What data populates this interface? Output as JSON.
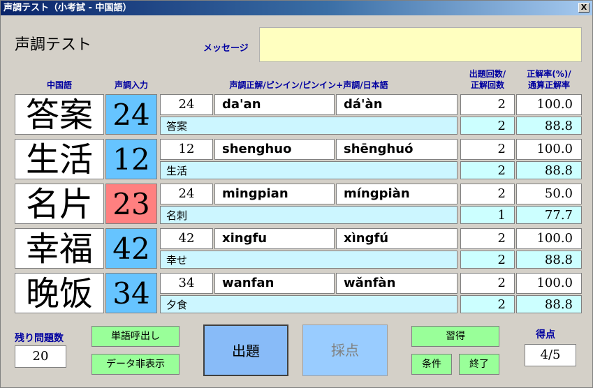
{
  "window": {
    "title": "声調テスト（小考試 - 中国語）",
    "close_label": "X"
  },
  "app": {
    "title": "声調テスト",
    "message_label": "メッセージ",
    "message_value": ""
  },
  "headers": {
    "chinese": "中国語",
    "tone_input": "声調入力",
    "answers": "声調正解/ピンイン/ピンイン+声調/日本語",
    "count1": "出題回数/",
    "count2": "正解回数",
    "rate1": "正解率(%)/",
    "rate2": "通算正解率"
  },
  "rows": [
    {
      "word": "答案",
      "tone_input": "24",
      "tone_correct": "24",
      "pinyin": "da'an",
      "pinyin_tone": "dá'àn",
      "japanese": "答案",
      "asked": "2",
      "correct": "2",
      "rate": "100.0",
      "total_rate": "88.8",
      "status": "correct"
    },
    {
      "word": "生活",
      "tone_input": "12",
      "tone_correct": "12",
      "pinyin": "shenghuo",
      "pinyin_tone": "shēnghuó",
      "japanese": "生活",
      "asked": "2",
      "correct": "2",
      "rate": "100.0",
      "total_rate": "88.8",
      "status": "correct"
    },
    {
      "word": "名片",
      "tone_input": "23",
      "tone_correct": "24",
      "pinyin": "mingpian",
      "pinyin_tone": "míngpiàn",
      "japanese": "名刺",
      "asked": "2",
      "correct": "1",
      "rate": "50.0",
      "total_rate": "77.7",
      "status": "wrong"
    },
    {
      "word": "幸福",
      "tone_input": "42",
      "tone_correct": "42",
      "pinyin": "xingfu",
      "pinyin_tone": "xìngfú",
      "japanese": "幸せ",
      "asked": "2",
      "correct": "2",
      "rate": "100.0",
      "total_rate": "88.8",
      "status": "correct"
    },
    {
      "word": "晚饭",
      "tone_input": "34",
      "tone_correct": "34",
      "pinyin": "wanfan",
      "pinyin_tone": "wǎnfàn",
      "japanese": "夕食",
      "asked": "2",
      "correct": "2",
      "rate": "100.0",
      "total_rate": "88.8",
      "status": "correct"
    }
  ],
  "footer": {
    "remaining_label": "残り問題数",
    "remaining_value": "20",
    "word_call_button": "単語呼出し",
    "hide_data_button": "データ非表示",
    "ask_button": "出題",
    "grade_button": "採点",
    "learned_button": "習得",
    "condition_button": "条件",
    "exit_button": "終了",
    "score_label": "得点",
    "score_value": "4/5"
  },
  "colors": {
    "tone_correct_bg": "#66c4ff",
    "tone_wrong_bg": "#ff8080",
    "accent_text": "#0000a0"
  }
}
